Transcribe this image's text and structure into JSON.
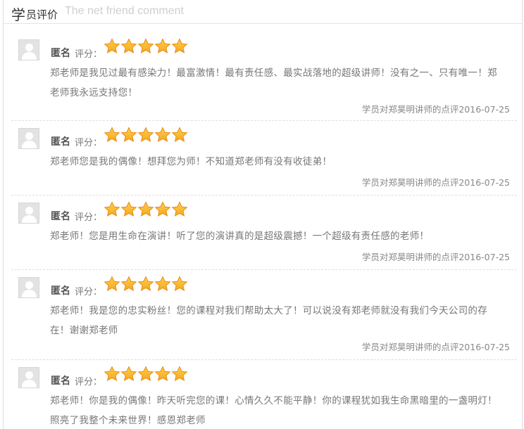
{
  "header": {
    "title_big": "学",
    "title_small": "员评价",
    "subtitle": "The net friend comment"
  },
  "colors": {
    "star": "#f5a623",
    "star_edge": "#e88a12"
  },
  "reviews": [
    {
      "name": "匿名",
      "score_label": "评分：",
      "stars": 5,
      "lines": [
        "郑老师是我见过最有感染力！最富激情！最有责任感、最实战落地的超级讲师！没有之一、只有唯一！郑",
        "老师我永远支持您！"
      ],
      "meta": "学员对郑昊明讲师的点评2016-07-25"
    },
    {
      "name": "匿名",
      "score_label": "评分：",
      "stars": 5,
      "lines": [
        "郑老师您是我的偶像！想拜您为师！不知道郑老师有没有收徒弟！"
      ],
      "meta": "学员对郑昊明讲师的点评2016-07-25"
    },
    {
      "name": "匿名",
      "score_label": "评分：",
      "stars": 5,
      "lines": [
        "郑老师！您是用生命在演讲！听了您的演讲真的是超级震撼！一个超级有责任感的老师！"
      ],
      "meta": "学员对郑昊明讲师的点评2016-07-25"
    },
    {
      "name": "匿名",
      "score_label": "评分：",
      "stars": 5,
      "lines": [
        "郑老师！我是您的忠实粉丝！您的课程对我们帮助太大了！可以说没有郑老师就没有我们今天公司的存",
        "在！谢谢郑老师"
      ],
      "meta": "学员对郑昊明讲师的点评2016-07-25"
    },
    {
      "name": "匿名",
      "score_label": "评分：",
      "stars": 5,
      "lines": [
        "郑老师！你是我的偶像！昨天听完您的课！心情久久不能平静！你的课程犹如我生命黑暗里的一盏明灯！",
        "照亮了我整个未来世界！感恩郑老师"
      ],
      "meta": ""
    }
  ]
}
